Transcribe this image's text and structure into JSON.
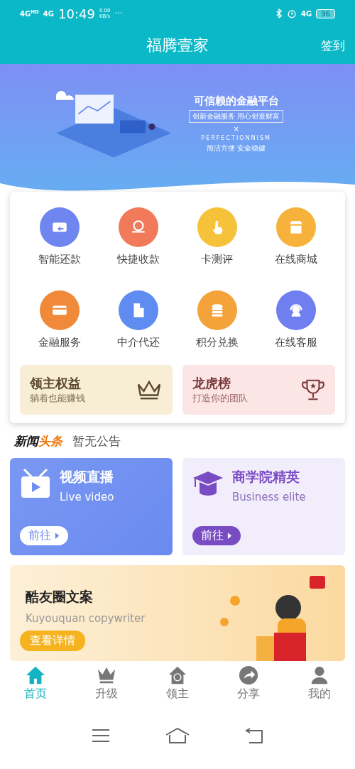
{
  "status_bar": {
    "network_1": "4G",
    "network_1_sup": "HD",
    "network_2": "4G",
    "time": "10:49",
    "speed": "0.00",
    "speed_unit": "KB/s",
    "more": "···",
    "net_type": "4G",
    "battery": "96"
  },
  "header": {
    "title": "福腾壹家",
    "action": "签到"
  },
  "banner": {
    "headline": "可信赖的金融平台",
    "tagline": "创新金融服务  用心创造财富",
    "cross": "×",
    "brand": "PERFECTIONNISM",
    "slogan": "简洁方便  安全稳健"
  },
  "services": [
    {
      "label": "智能还款",
      "color": "#6f86f0",
      "kind": "repay"
    },
    {
      "label": "快捷收款",
      "color": "#f07a5a",
      "kind": "collect"
    },
    {
      "label": "卡测评",
      "color": "#f6c23a",
      "kind": "rate"
    },
    {
      "label": "在线商城",
      "color": "#f6b23a",
      "kind": "shop"
    },
    {
      "label": "金融服务",
      "color": "#f08a3a",
      "kind": "finance"
    },
    {
      "label": "中介代还",
      "color": "#5f8cf0",
      "kind": "agent"
    },
    {
      "label": "积分兑换",
      "color": "#f4a23a",
      "kind": "points"
    },
    {
      "label": "在线客服",
      "color": "#6f7ff0",
      "kind": "support"
    }
  ],
  "promos": [
    {
      "title": "领主权益",
      "subtitle": "躺着也能赚钱",
      "kind": "crown"
    },
    {
      "title": "龙虎榜",
      "subtitle": "打造你的团队",
      "kind": "trophy"
    }
  ],
  "news": {
    "label_a": "新闻",
    "label_b": "头条",
    "text": "暂无公告"
  },
  "feature_cards": [
    {
      "title": "视频直播",
      "subtitle": "Live video",
      "button": "前往",
      "kind": "video"
    },
    {
      "title": "商学院精英",
      "subtitle": "Business elite",
      "button": "前往",
      "kind": "school"
    }
  ],
  "wide_card": {
    "title": "酷友圈文案",
    "subtitle": "Kuyouquan copywriter",
    "button": "查看详情"
  },
  "tabbar": [
    {
      "label": "首页",
      "selected": true,
      "kind": "home"
    },
    {
      "label": "升级",
      "selected": false,
      "kind": "upgrade"
    },
    {
      "label": "领主",
      "selected": false,
      "kind": "lord"
    },
    {
      "label": "分享",
      "selected": false,
      "kind": "share"
    },
    {
      "label": "我的",
      "selected": false,
      "kind": "mine"
    }
  ]
}
